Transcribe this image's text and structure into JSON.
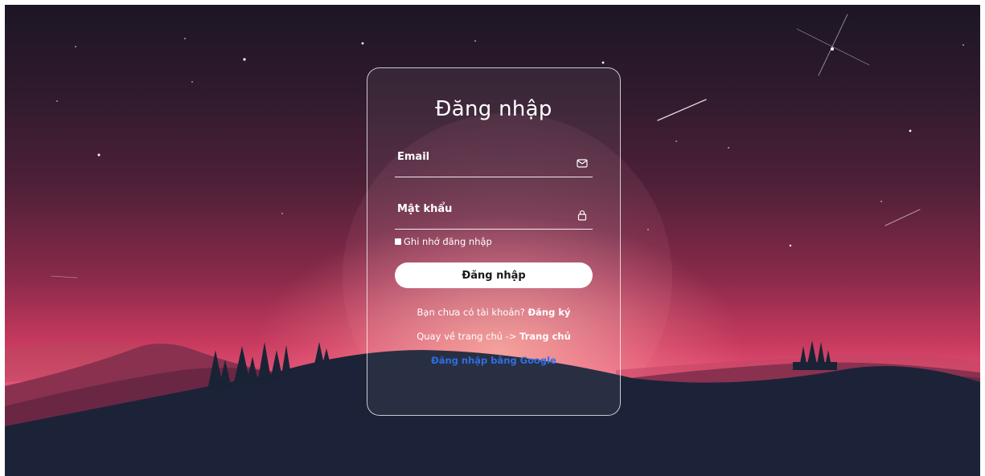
{
  "login": {
    "title": "Đăng nhập",
    "email_label": "Email",
    "password_label": "Mật khẩu",
    "remember_label": "Ghi nhớ đăng nhập",
    "submit_label": "Đăng nhập",
    "signup_prompt": "Bạn chưa có tài khoản?",
    "signup_link": "Đăng ký",
    "home_prompt": "Quay về trang chủ ->",
    "home_link": "Trang chủ",
    "google_link": "Đăng nhập bằng Google"
  },
  "icons": {
    "email": "mail-icon",
    "password": "lock-icon"
  },
  "colors": {
    "google_link": "#2d6fe0",
    "button_bg": "#ffffff"
  }
}
